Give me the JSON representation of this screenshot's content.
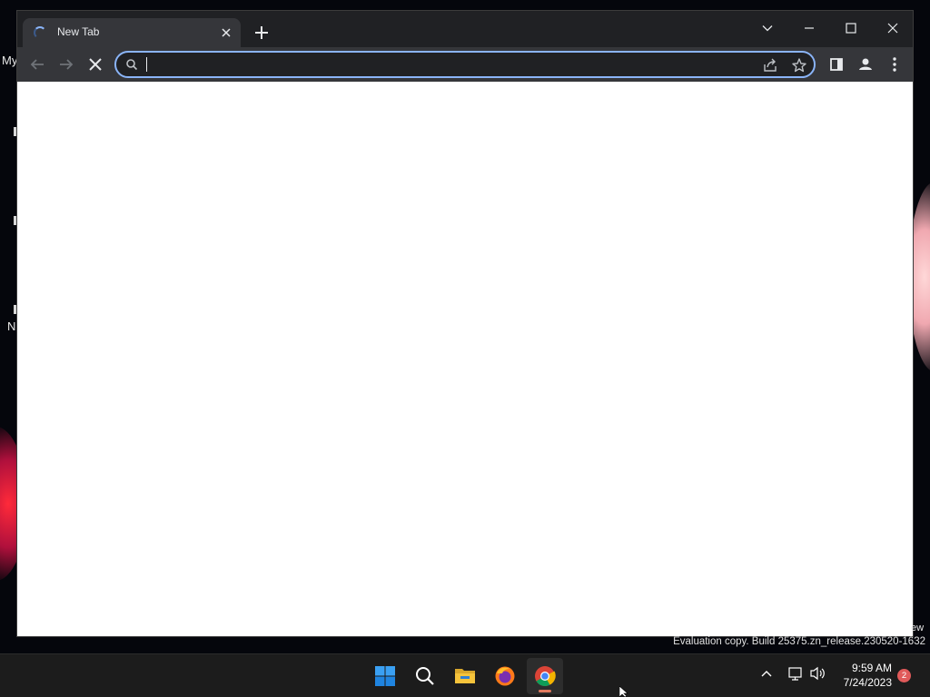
{
  "desktop": {
    "fragment_top": "My",
    "fragment_mid": "N",
    "watermark_fragment": "ew",
    "watermark": "Evaluation copy. Build 25375.zn_release.230520-1632"
  },
  "browser": {
    "tab": {
      "title": "New Tab",
      "loading": true
    },
    "omnibox": {
      "value": "",
      "placeholder": ""
    },
    "accent": "#8ab4f8"
  },
  "taskbar": {
    "apps": [
      {
        "name": "Start",
        "icon": "windows-logo-icon"
      },
      {
        "name": "Search",
        "icon": "search-icon"
      },
      {
        "name": "File Explorer",
        "icon": "folder-icon"
      },
      {
        "name": "Firefox",
        "icon": "firefox-icon"
      },
      {
        "name": "Google Chrome",
        "icon": "chrome-icon",
        "active": true
      }
    ],
    "clock": {
      "time": "9:59 AM",
      "date": "7/24/2023"
    },
    "notifications": "2"
  }
}
